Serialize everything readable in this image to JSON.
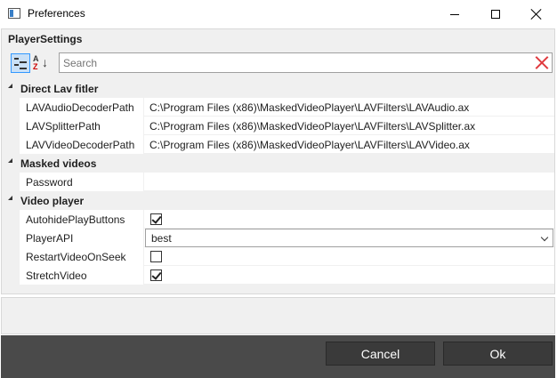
{
  "window": {
    "title": "Preferences"
  },
  "grid": {
    "header": "PlayerSettings",
    "search": {
      "placeholder": "Search",
      "value": ""
    },
    "categories": [
      {
        "label": "Direct Lav fitler",
        "properties": [
          {
            "name": "LAVAudioDecoderPath",
            "value": "C:\\Program Files (x86)\\MaskedVideoPlayer\\LAVFilters\\LAVAudio.ax"
          },
          {
            "name": "LAVSplitterPath",
            "value": "C:\\Program Files (x86)\\MaskedVideoPlayer\\LAVFilters\\LAVSplitter.ax"
          },
          {
            "name": "LAVVideoDecoderPath",
            "value": "C:\\Program Files (x86)\\MaskedVideoPlayer\\LAVFilters\\LAVVideo.ax"
          }
        ]
      },
      {
        "label": "Masked videos",
        "properties": [
          {
            "name": "Password",
            "value": ""
          }
        ]
      },
      {
        "label": "Video player",
        "properties": [
          {
            "name": "AutohidePlayButtons",
            "checked": true
          },
          {
            "name": "PlayerAPI",
            "value": "best"
          },
          {
            "name": "RestartVideoOnSeek",
            "checked": false
          },
          {
            "name": "StretchVideo",
            "checked": true
          }
        ]
      }
    ]
  },
  "footer": {
    "cancel_label": "Cancel",
    "ok_label": "Ok"
  },
  "colors": {
    "footer_bg": "#4a4a4a",
    "button_bg": "#3a3a3a",
    "panel_bg": "#f0f0f0",
    "clear_icon": "#e0393e",
    "toggle_active": "#3399ff"
  }
}
